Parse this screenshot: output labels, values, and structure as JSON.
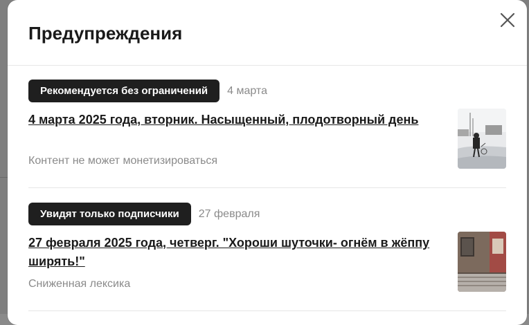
{
  "modal": {
    "title": "Предупреждения"
  },
  "warnings": [
    {
      "badge": "Рекомендуется без ограничений",
      "date": "4 марта",
      "title": "4 марта 2025 года, вторник. Насыщенный, плодотворный день",
      "note": "Контент не может монетизироваться",
      "thumbnail_icon": "winter-street-photo"
    },
    {
      "badge": "Увидят только подписчики",
      "date": "27 февраля",
      "title": "27 февраля 2025 года, четверг. \"Хороши шуточки- огнём в жёппу ширять!\"",
      "note": "Сниженная лексика",
      "thumbnail_icon": "building-photo"
    }
  ],
  "icons": {
    "close": "close-icon"
  },
  "colors": {
    "badge_bg": "#1f1f1f",
    "muted_text": "#8a8a8a",
    "title_text": "#1a1a1a"
  }
}
